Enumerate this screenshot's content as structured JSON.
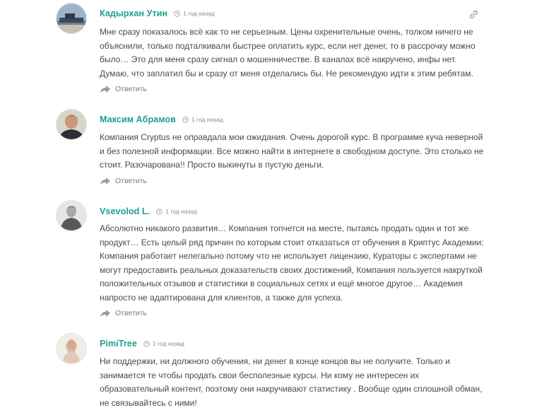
{
  "comments": [
    {
      "author": "Кадырхан Утин",
      "time": "1 год назад",
      "text": "Мне сразу показалось всё как то не серьезным. Цены охренительные очень, толком ничего не объяснили, только подталкивали быстрее оплатить курс, если нет денег, то в рассрочку можно было… Это для меня сразу сигнал о мошенничестве. В каналах всё накручено, инфы нет. Думаю, что заплатил бы и сразу от меня отделались бы. Не рекомендую идти к этим ребятам.",
      "reply_label": "Ответить"
    },
    {
      "author": "Максим Абрамов",
      "time": "1 год назад",
      "text": "Компания Cryptus не оправдала мои ожидания. Очень дорогой курс. В программе куча неверной и без полезной информации. Все можно найти в интернете в свободном доступе. Это столько не стоит. Разочарована!! Просто выкинуты в пустую деньги.",
      "reply_label": "Ответить"
    },
    {
      "author": "Vsevolod L.",
      "time": "1 год назад",
      "text": "Абсолютно никакого развития… Компания топчется на месте, пытаясь продать один и тот же продукт… Есть целый ряд причин по которым стоит отказаться от обучения в Криптус Академии: Компания работает нелегально потому что не использует лицензию, Кураторы с экспертами не могут предоставить реальных доказательств своих достижений, Компания пользуется накруткой положительных отзывов и статистики в социальных сетях и ещё многое другое… Академия напросто не адаптирована для клиентов, а также для успеха.",
      "reply_label": "Ответить"
    },
    {
      "author": "PimiTree",
      "time": "1 год назад",
      "text": "Ни поддержки, ни должного обучения, ни денег в конце концов вы не получите. Только и занимается те чтобы продать свои бесполезные курсы. Ни кому не интересен их образовательный контент, поэтому они накручивают статистику . Вообще один сплошной обман, не связывайтесь с ними!"
    }
  ],
  "icons": {
    "clock": "clock-icon",
    "link": "link-icon",
    "reply": "reply-arrow-icon"
  },
  "colors": {
    "author": "#1f9e8c",
    "text": "#4a4a4a",
    "muted": "#8a8a8a"
  }
}
